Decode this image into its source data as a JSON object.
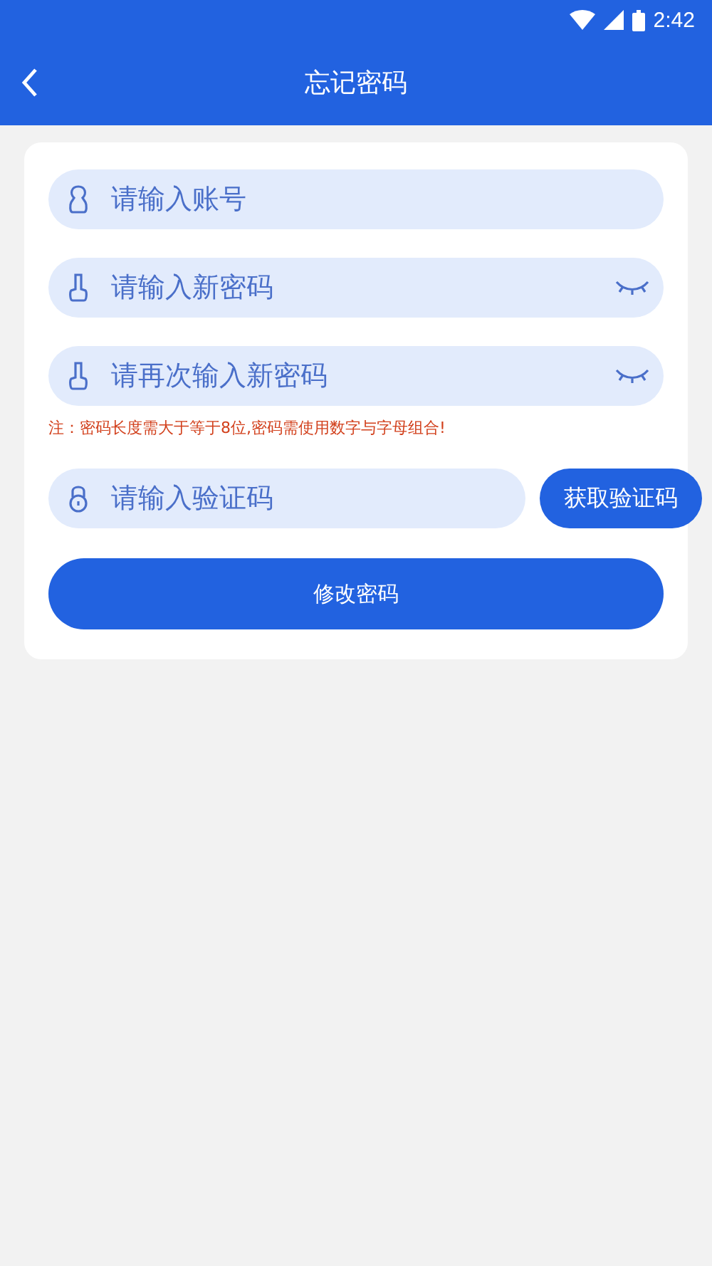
{
  "status_bar": {
    "time": "2:42"
  },
  "header": {
    "title": "忘记密码"
  },
  "fields": [
    {
      "kind": "account",
      "placeholder": "请输入账号"
    },
    {
      "kind": "password",
      "placeholder": "请输入新密码"
    },
    {
      "kind": "password",
      "placeholder": "请再次输入新密码"
    }
  ],
  "note": "注：密码长度需大于等于8位,密码需使用数字与字母组合!",
  "code": {
    "placeholder": "请输入验证码",
    "button": "获取验证码"
  },
  "submit": "修改密码"
}
